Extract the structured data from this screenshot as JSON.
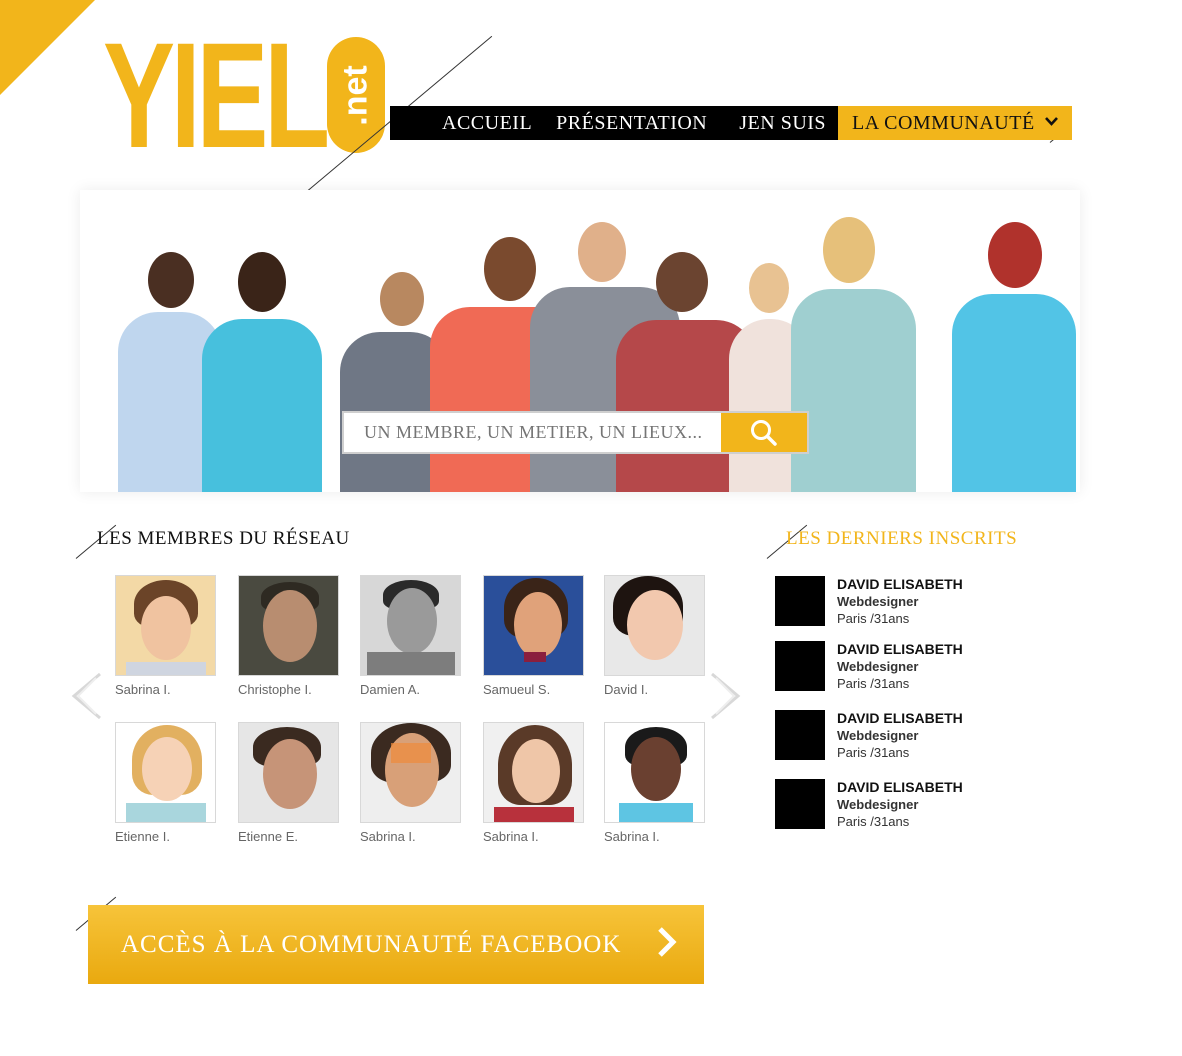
{
  "logo": {
    "text": "YIEL",
    "suffix": ".net"
  },
  "nav": {
    "items": [
      "ACCUEIL",
      "PRÉSENTATION",
      "JEN SUIS"
    ],
    "active": "LA COMMUNAUTÉ"
  },
  "search": {
    "placeholder": "UN MEMBRE, UN METIER, UN LIEUX....."
  },
  "members_section": {
    "title": "LES MEMBRES DU RÉSEAU",
    "members": [
      {
        "name": "Sabrina I."
      },
      {
        "name": "Christophe I."
      },
      {
        "name": "Damien A."
      },
      {
        "name": "Samueul S."
      },
      {
        "name": "David I."
      },
      {
        "name": "Etienne I."
      },
      {
        "name": "Etienne E."
      },
      {
        "name": "Sabrina I."
      },
      {
        "name": "Sabrina I."
      },
      {
        "name": "Sabrina I."
      }
    ]
  },
  "latest_section": {
    "title": "LES DERNIERS INSCRITS",
    "entries": [
      {
        "name": "DAVID ELISABETH",
        "job": "Webdesigner",
        "location": "Paris /31ans"
      },
      {
        "name": "DAVID ELISABETH",
        "job": "Webdesigner",
        "location": "Paris /31ans"
      },
      {
        "name": "DAVID ELISABETH",
        "job": "Webdesigner",
        "location": "Paris /31ans"
      },
      {
        "name": "DAVID ELISABETH",
        "job": "Webdesigner",
        "location": "Paris /31ans"
      }
    ]
  },
  "facebook_button": {
    "label": "ACCÈS À LA COMMUNAUTÉ FACEBOOK"
  },
  "colors": {
    "accent": "#f2b51b",
    "nav_bg": "#000000"
  },
  "icons": {
    "search": "magnifier-icon",
    "prev": "chevron-left-icon",
    "next": "chevron-right-icon",
    "dropdown": "chevron-down-icon",
    "cta": "chevron-right-icon"
  }
}
